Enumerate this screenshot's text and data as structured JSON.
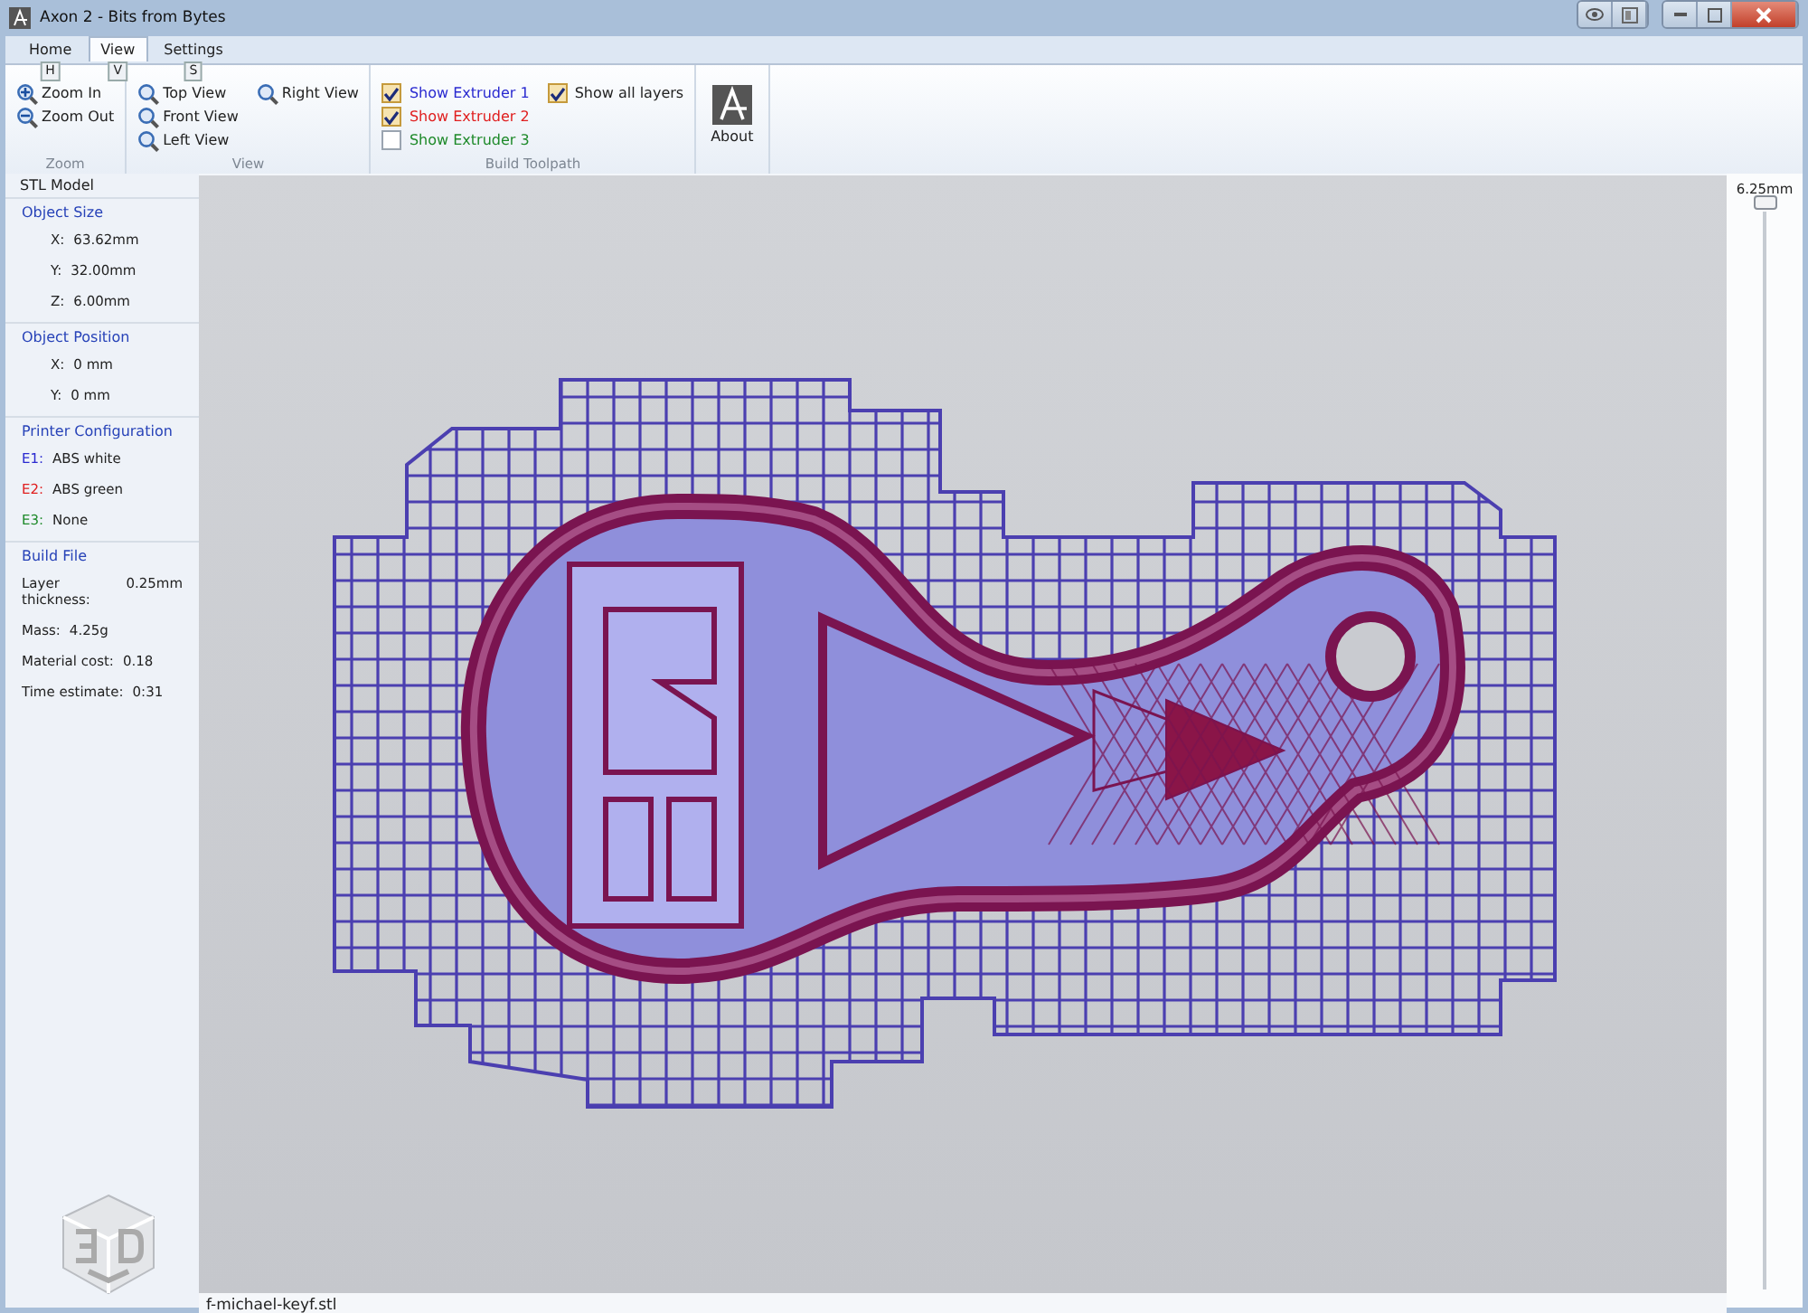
{
  "window": {
    "title": "Axon 2 - Bits from Bytes"
  },
  "tabs": [
    {
      "label": "Home",
      "key_tip": "H",
      "selected": false
    },
    {
      "label": "View",
      "key_tip": "V",
      "selected": true
    },
    {
      "label": "Settings",
      "key_tip": "S",
      "selected": false
    }
  ],
  "ribbon": {
    "groups": [
      {
        "kind": "zoom",
        "label": "Zoom",
        "columns": [
          [
            {
              "label": "Zoom In"
            },
            {
              "label": "Zoom Out"
            }
          ]
        ]
      },
      {
        "kind": "view",
        "label": "View",
        "columns": [
          [
            {
              "label": "Top View"
            },
            {
              "label": "Front View"
            },
            {
              "label": "Left View"
            }
          ],
          [
            {
              "label": "Right View"
            }
          ]
        ]
      },
      {
        "kind": "checks",
        "label": "Build Toolpath",
        "columns": [
          [
            {
              "label": "Show Extruder 1",
              "checked": true,
              "color": "#2a2ad0"
            },
            {
              "label": "Show Extruder 2",
              "checked": true,
              "color": "#e02020"
            },
            {
              "label": "Show Extruder 3",
              "checked": false,
              "color": "#1e8a2a"
            }
          ],
          [
            {
              "label": "Show all layers",
              "checked": true,
              "color": "#222222"
            }
          ]
        ]
      },
      {
        "kind": "large",
        "columns": [
          [
            {
              "label": "About"
            }
          ]
        ]
      }
    ]
  },
  "sidebar": {
    "title": "STL Model",
    "sections": [
      {
        "heading": "Object Size",
        "rows": [
          {
            "key": "X:",
            "value": "63.62mm",
            "indent": true
          },
          {
            "key": "Y:",
            "value": "32.00mm",
            "indent": true
          },
          {
            "key": "Z:",
            "value": "6.00mm",
            "indent": true
          }
        ]
      },
      {
        "heading": "Object Position",
        "rows": [
          {
            "key": "X:",
            "value": "0 mm",
            "indent": true
          },
          {
            "key": "Y:",
            "value": "0 mm",
            "indent": true
          }
        ]
      },
      {
        "heading": "Printer Configuration",
        "rows": [
          {
            "key": "E1:",
            "value": "ABS white",
            "color": "#2a2ad0"
          },
          {
            "key": "E2:",
            "value": "ABS green",
            "color": "#e02020"
          },
          {
            "key": "E3:",
            "value": "None",
            "color": "#1e8a2a"
          }
        ]
      },
      {
        "heading": "Build File",
        "rows": [
          {
            "key": "Layer thickness:",
            "value": "0.25mm"
          },
          {
            "key": "Mass:",
            "value": "4.25g"
          },
          {
            "key": "Material cost:",
            "value": "0.18"
          },
          {
            "key": "Time estimate:",
            "value": "0:31"
          }
        ]
      }
    ]
  },
  "layer_slider": {
    "reading": "6.25mm",
    "level": 1
  },
  "status": {
    "file_name": "f-michael-keyf.stl"
  }
}
